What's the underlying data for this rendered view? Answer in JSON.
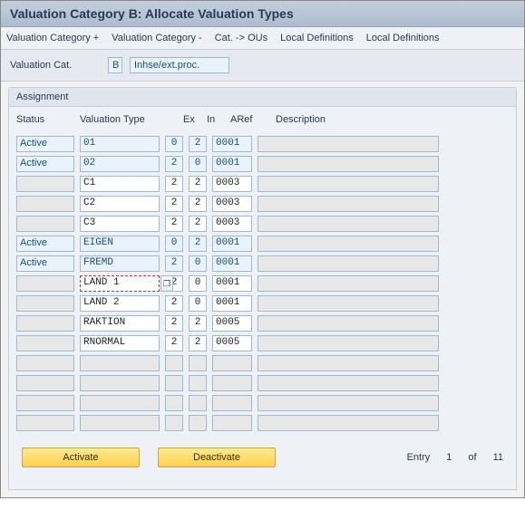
{
  "title": "Valuation Category B: Allocate Valuation Types",
  "menu": [
    "Valuation Category +",
    "Valuation Category -",
    "Cat. -> OUs",
    "Local Definitions",
    "Local Definitions"
  ],
  "header": {
    "label": "Valuation Cat.",
    "code": "B",
    "desc": "Inhse/ext.proc."
  },
  "group_title": "Assignment",
  "columns": {
    "status": "Status",
    "type": "Valuation Type",
    "ex": "Ex",
    "in": "In",
    "aref": "ARef",
    "desc": "Description"
  },
  "rows": [
    {
      "status": "Active",
      "status_mode": "blue",
      "type": "01",
      "type_mode": "ro",
      "ex": "0",
      "ex_mode": "ro",
      "in": "2",
      "in_mode": "ro",
      "aref": "0001",
      "aref_mode": "ro",
      "focus": false
    },
    {
      "status": "Active",
      "status_mode": "blue",
      "type": "02",
      "type_mode": "ro",
      "ex": "2",
      "ex_mode": "ro",
      "in": "0",
      "in_mode": "ro",
      "aref": "0001",
      "aref_mode": "ro",
      "focus": false
    },
    {
      "status": "",
      "status_mode": "grey",
      "type": "C1",
      "type_mode": "plain",
      "ex": "2",
      "ex_mode": "plain",
      "in": "2",
      "in_mode": "plain",
      "aref": "0003",
      "aref_mode": "plain",
      "focus": false
    },
    {
      "status": "",
      "status_mode": "grey",
      "type": "C2",
      "type_mode": "plain",
      "ex": "2",
      "ex_mode": "plain",
      "in": "2",
      "in_mode": "plain",
      "aref": "0003",
      "aref_mode": "plain",
      "focus": false
    },
    {
      "status": "",
      "status_mode": "grey",
      "type": "C3",
      "type_mode": "plain",
      "ex": "2",
      "ex_mode": "plain",
      "in": "2",
      "in_mode": "plain",
      "aref": "0003",
      "aref_mode": "plain",
      "focus": false
    },
    {
      "status": "Active",
      "status_mode": "blue",
      "type": "EIGEN",
      "type_mode": "ro",
      "ex": "0",
      "ex_mode": "ro",
      "in": "2",
      "in_mode": "ro",
      "aref": "0001",
      "aref_mode": "ro",
      "focus": false
    },
    {
      "status": "Active",
      "status_mode": "blue",
      "type": "FREMD",
      "type_mode": "ro",
      "ex": "2",
      "ex_mode": "ro",
      "in": "0",
      "in_mode": "ro",
      "aref": "0001",
      "aref_mode": "ro",
      "focus": false
    },
    {
      "status": "",
      "status_mode": "grey",
      "type": "LAND 1",
      "type_mode": "plain",
      "ex": "2",
      "ex_mode": "plain",
      "in": "0",
      "in_mode": "plain",
      "aref": "0001",
      "aref_mode": "plain",
      "focus": true
    },
    {
      "status": "",
      "status_mode": "grey",
      "type": "LAND 2",
      "type_mode": "plain",
      "ex": "2",
      "ex_mode": "plain",
      "in": "0",
      "in_mode": "plain",
      "aref": "0001",
      "aref_mode": "plain",
      "focus": false
    },
    {
      "status": "",
      "status_mode": "grey",
      "type": "RAKTION",
      "type_mode": "plain",
      "ex": "2",
      "ex_mode": "plain",
      "in": "2",
      "in_mode": "plain",
      "aref": "0005",
      "aref_mode": "plain",
      "focus": false
    },
    {
      "status": "",
      "status_mode": "grey",
      "type": "RNORMAL",
      "type_mode": "plain",
      "ex": "2",
      "ex_mode": "plain",
      "in": "2",
      "in_mode": "plain",
      "aref": "0005",
      "aref_mode": "plain",
      "focus": false
    },
    {
      "status": "",
      "status_mode": "grey",
      "type": "",
      "type_mode": "grey",
      "ex": "",
      "ex_mode": "grey",
      "in": "",
      "in_mode": "grey",
      "aref": "",
      "aref_mode": "grey",
      "focus": false
    },
    {
      "status": "",
      "status_mode": "grey",
      "type": "",
      "type_mode": "grey",
      "ex": "",
      "ex_mode": "grey",
      "in": "",
      "in_mode": "grey",
      "aref": "",
      "aref_mode": "grey",
      "focus": false
    },
    {
      "status": "",
      "status_mode": "grey",
      "type": "",
      "type_mode": "grey",
      "ex": "",
      "ex_mode": "grey",
      "in": "",
      "in_mode": "grey",
      "aref": "",
      "aref_mode": "grey",
      "focus": false
    },
    {
      "status": "",
      "status_mode": "grey",
      "type": "",
      "type_mode": "grey",
      "ex": "",
      "ex_mode": "grey",
      "in": "",
      "in_mode": "grey",
      "aref": "",
      "aref_mode": "grey",
      "focus": false
    }
  ],
  "buttons": {
    "activate": "Activate",
    "deactivate": "Deactivate"
  },
  "entry_info": {
    "label": "Entry",
    "current": "1",
    "of": "of",
    "total": "11"
  }
}
